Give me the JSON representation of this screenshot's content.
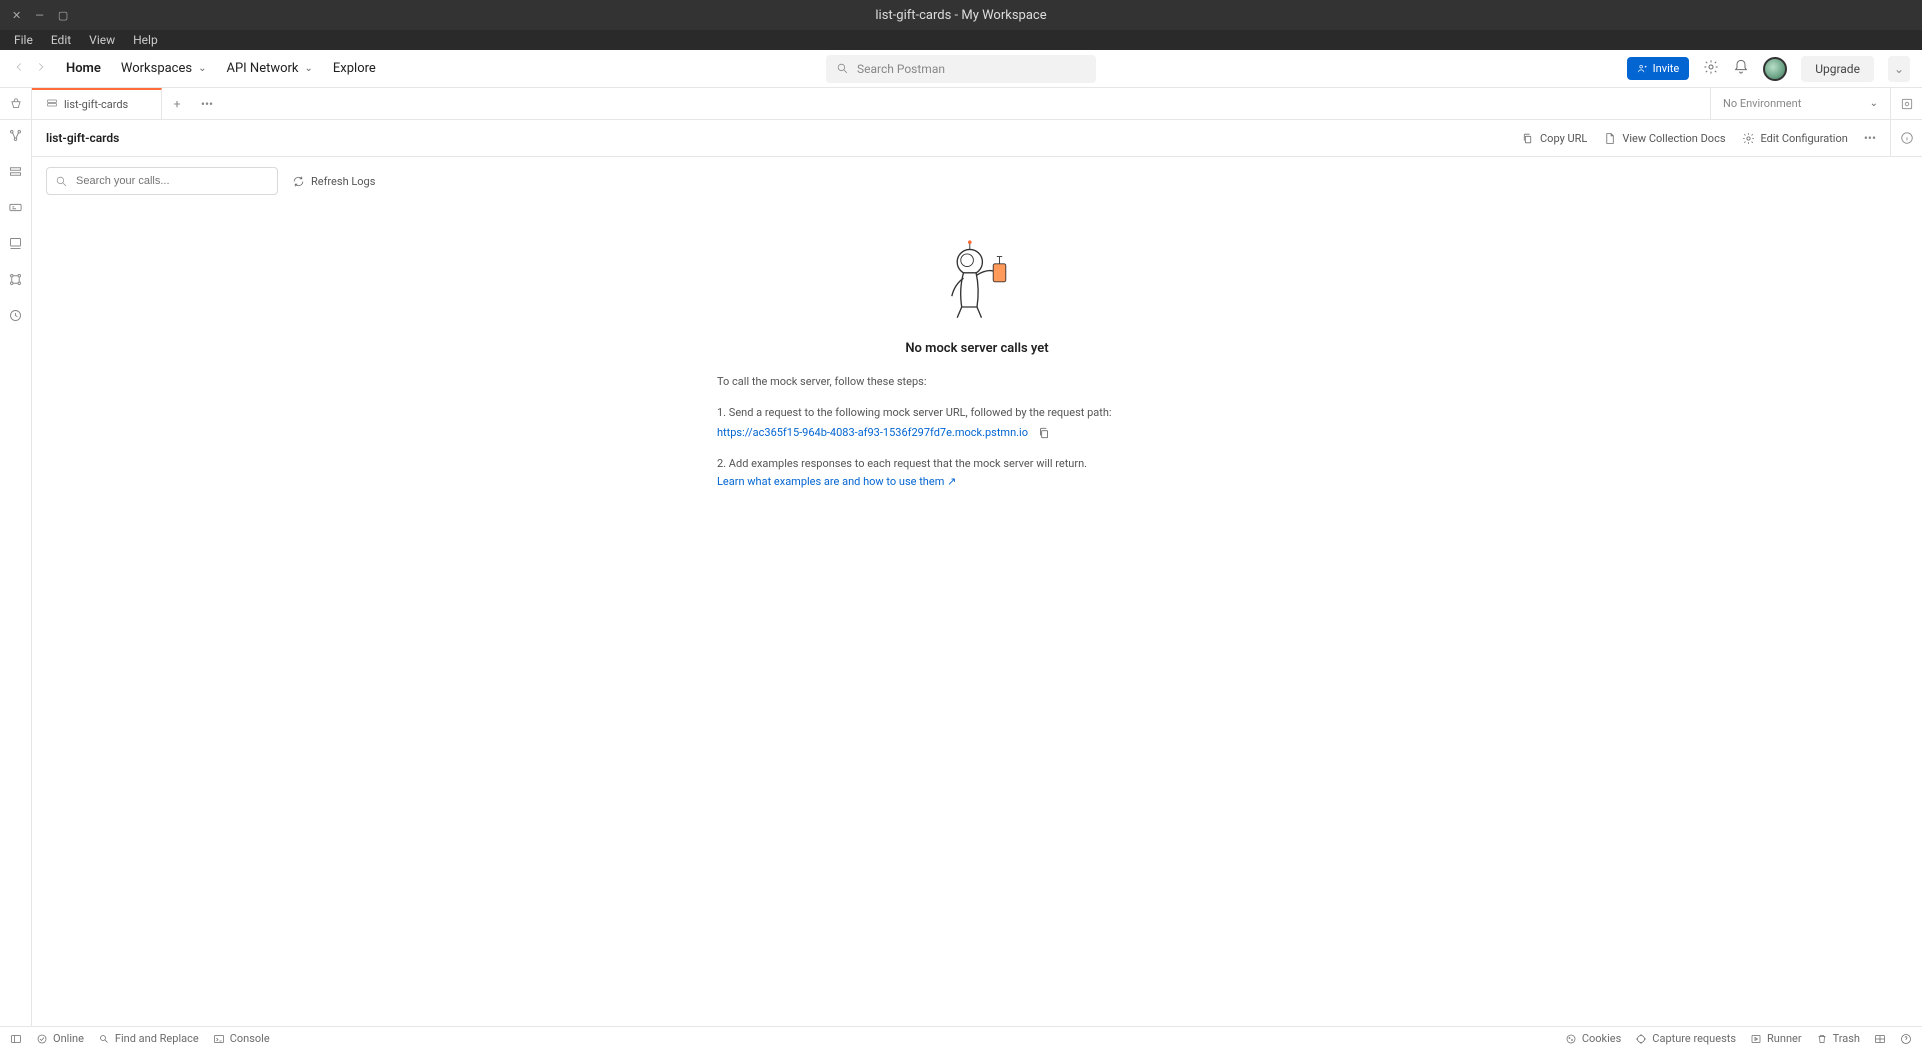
{
  "window": {
    "title": "list-gift-cards - My Workspace"
  },
  "menu": {
    "file": "File",
    "edit": "Edit",
    "view": "View",
    "help": "Help"
  },
  "nav": {
    "home": "Home",
    "workspaces": "Workspaces",
    "api_network": "API Network",
    "explore": "Explore",
    "search_placeholder": "Search Postman",
    "invite": "Invite",
    "upgrade": "Upgrade"
  },
  "tabs": {
    "active": "list-gift-cards"
  },
  "env": {
    "selected": "No Environment"
  },
  "page": {
    "title": "list-gift-cards",
    "actions": {
      "copy_url": "Copy URL",
      "view_docs": "View Collection Docs",
      "edit_config": "Edit Configuration"
    },
    "search_placeholder": "Search your calls...",
    "refresh": "Refresh Logs"
  },
  "empty": {
    "heading": "No mock server calls yet",
    "intro": "To call the mock server, follow these steps:",
    "step1": "1. Send a request to the following mock server URL, followed by the request path:",
    "url": "https://ac365f15-964b-4083-af93-1536f297fd7e.mock.pstmn.io",
    "step2": "2. Add examples responses to each request that the mock server will return.",
    "learn": "Learn what examples are and how to use them ↗"
  },
  "status": {
    "online": "Online",
    "find": "Find and Replace",
    "console": "Console",
    "cookies": "Cookies",
    "capture": "Capture requests",
    "runner": "Runner",
    "trash": "Trash"
  }
}
